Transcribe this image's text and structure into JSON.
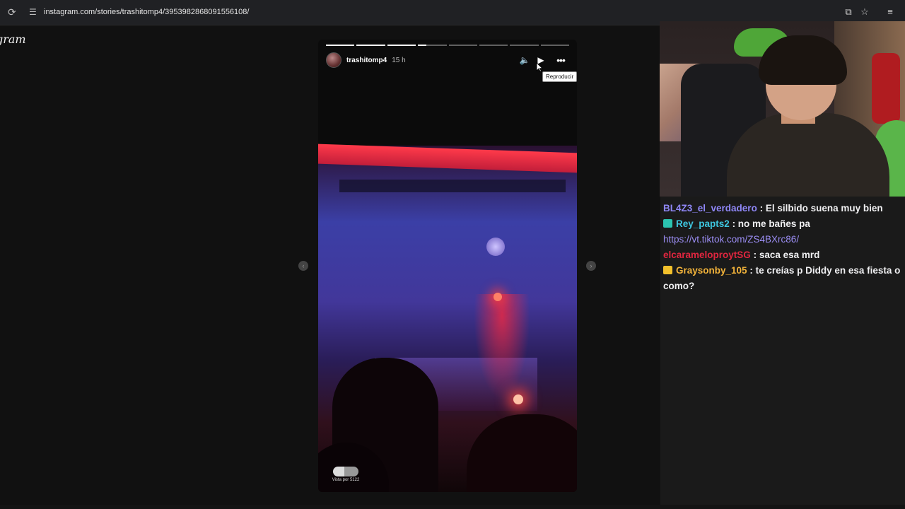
{
  "browser": {
    "url": "instagram.com/stories/trashitomp4/3953982868091556108/",
    "reload_icon": "reload-icon",
    "site_info_icon": "site-info-icon",
    "right_icons": [
      "install-app-icon",
      "bookmark-star-icon",
      "reading-list-icon"
    ]
  },
  "page": {
    "brand_partial": "gram"
  },
  "story": {
    "username": "trashitomp4",
    "time_ago": "15 h",
    "progress": [
      1.0,
      1.0,
      1.0,
      0.3,
      0.0,
      0.0,
      0.0,
      0.0
    ],
    "controls": {
      "mute_icon": "volume-icon",
      "play_icon": "play-icon",
      "more_icon": "more-options-icon"
    },
    "tooltip": "Reproducir",
    "views_label": "Vista por 5122",
    "prev_icon": "chevron-left-icon",
    "next_icon": "chevron-right-icon"
  },
  "chat": {
    "messages": [
      {
        "user": "BL4Z3_el_verdadero",
        "text": ": El silbido suena muy bien",
        "color": "#8f87f7",
        "badge": ""
      },
      {
        "user": "Rey_papts2",
        "text": ": no me bañes pa",
        "link": "https://vt.tiktok.com/ZS4BXrc86/",
        "color": "#3ec7e0",
        "badge": "#2bc4b0"
      },
      {
        "user": "elcarameloproytSG",
        "text": ": saca esa mrd",
        "color": "#e0263f",
        "badge": ""
      },
      {
        "user": "Graysonby_105",
        "text": ": te creías p Diddy en esa fiesta o como?",
        "color": "#f2b33a",
        "badge": "#f3c12c"
      }
    ]
  }
}
